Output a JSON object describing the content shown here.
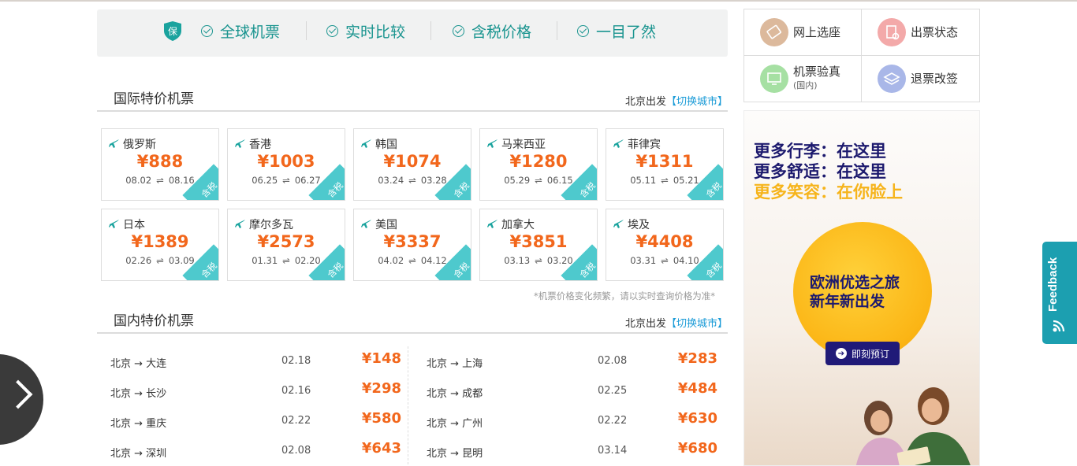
{
  "guarantee": {
    "shield_text": "保",
    "items": [
      "全球机票",
      "实时比较",
      "含税价格",
      "一目了然"
    ]
  },
  "international": {
    "title": "国际特价机票",
    "depart": "北京出发",
    "switch": "【切换城市】",
    "tax_label": "含税",
    "cards": [
      {
        "country": "俄罗斯",
        "price": "¥888",
        "from": "08.02",
        "to": "08.16"
      },
      {
        "country": "香港",
        "price": "¥1003",
        "from": "06.25",
        "to": "06.27"
      },
      {
        "country": "韩国",
        "price": "¥1074",
        "from": "03.24",
        "to": "03.28"
      },
      {
        "country": "马来西亚",
        "price": "¥1280",
        "from": "05.29",
        "to": "06.15"
      },
      {
        "country": "菲律宾",
        "price": "¥1311",
        "from": "05.11",
        "to": "05.21"
      },
      {
        "country": "日本",
        "price": "¥1389",
        "from": "02.26",
        "to": "03.09"
      },
      {
        "country": "摩尔多瓦",
        "price": "¥2573",
        "from": "01.31",
        "to": "02.20"
      },
      {
        "country": "美国",
        "price": "¥3337",
        "from": "04.02",
        "to": "04.12"
      },
      {
        "country": "加拿大",
        "price": "¥3851",
        "from": "03.13",
        "to": "03.20"
      },
      {
        "country": "埃及",
        "price": "¥4408",
        "from": "03.31",
        "to": "04.10"
      }
    ],
    "note": "*机票价格变化频繁，请以实时查询价格为准*"
  },
  "domestic": {
    "title": "国内特价机票",
    "depart": "北京出发",
    "switch": "【切换城市】",
    "left": [
      {
        "route": "北京 → 大连",
        "date": "02.18",
        "price": "¥148"
      },
      {
        "route": "北京 → 长沙",
        "date": "02.16",
        "price": "¥298"
      },
      {
        "route": "北京 → 重庆",
        "date": "02.22",
        "price": "¥580"
      },
      {
        "route": "北京 → 深圳",
        "date": "02.08",
        "price": "¥643"
      }
    ],
    "right": [
      {
        "route": "北京 → 上海",
        "date": "02.08",
        "price": "¥283"
      },
      {
        "route": "北京 → 成都",
        "date": "02.25",
        "price": "¥484"
      },
      {
        "route": "北京 → 广州",
        "date": "02.22",
        "price": "¥630"
      },
      {
        "route": "北京 → 昆明",
        "date": "03.14",
        "price": "¥680"
      }
    ]
  },
  "services": {
    "online_seat": "网上选座",
    "ticket_status": "出票状态",
    "verify": "机票验真",
    "verify_sub": "(国内)",
    "refund": "退票改签"
  },
  "ad": {
    "line1": "更多行李：在这里",
    "line2": "更多舒适：在这里",
    "line3": "更多笑容：在你脸上",
    "sun1": "欧洲优选之旅",
    "sun2": "新年新出发",
    "cta": "即刻预订"
  },
  "feedback": "Feedback",
  "colors": {
    "teal": "#19948f",
    "price_orange": "#f2671c",
    "tax_badge": "#4ec9cd",
    "link_blue": "#1a9bd7",
    "ad_navy": "#1d1a6e",
    "ad_yellow": "#f6b41b",
    "feedback_bg": "#1c9fb0"
  }
}
